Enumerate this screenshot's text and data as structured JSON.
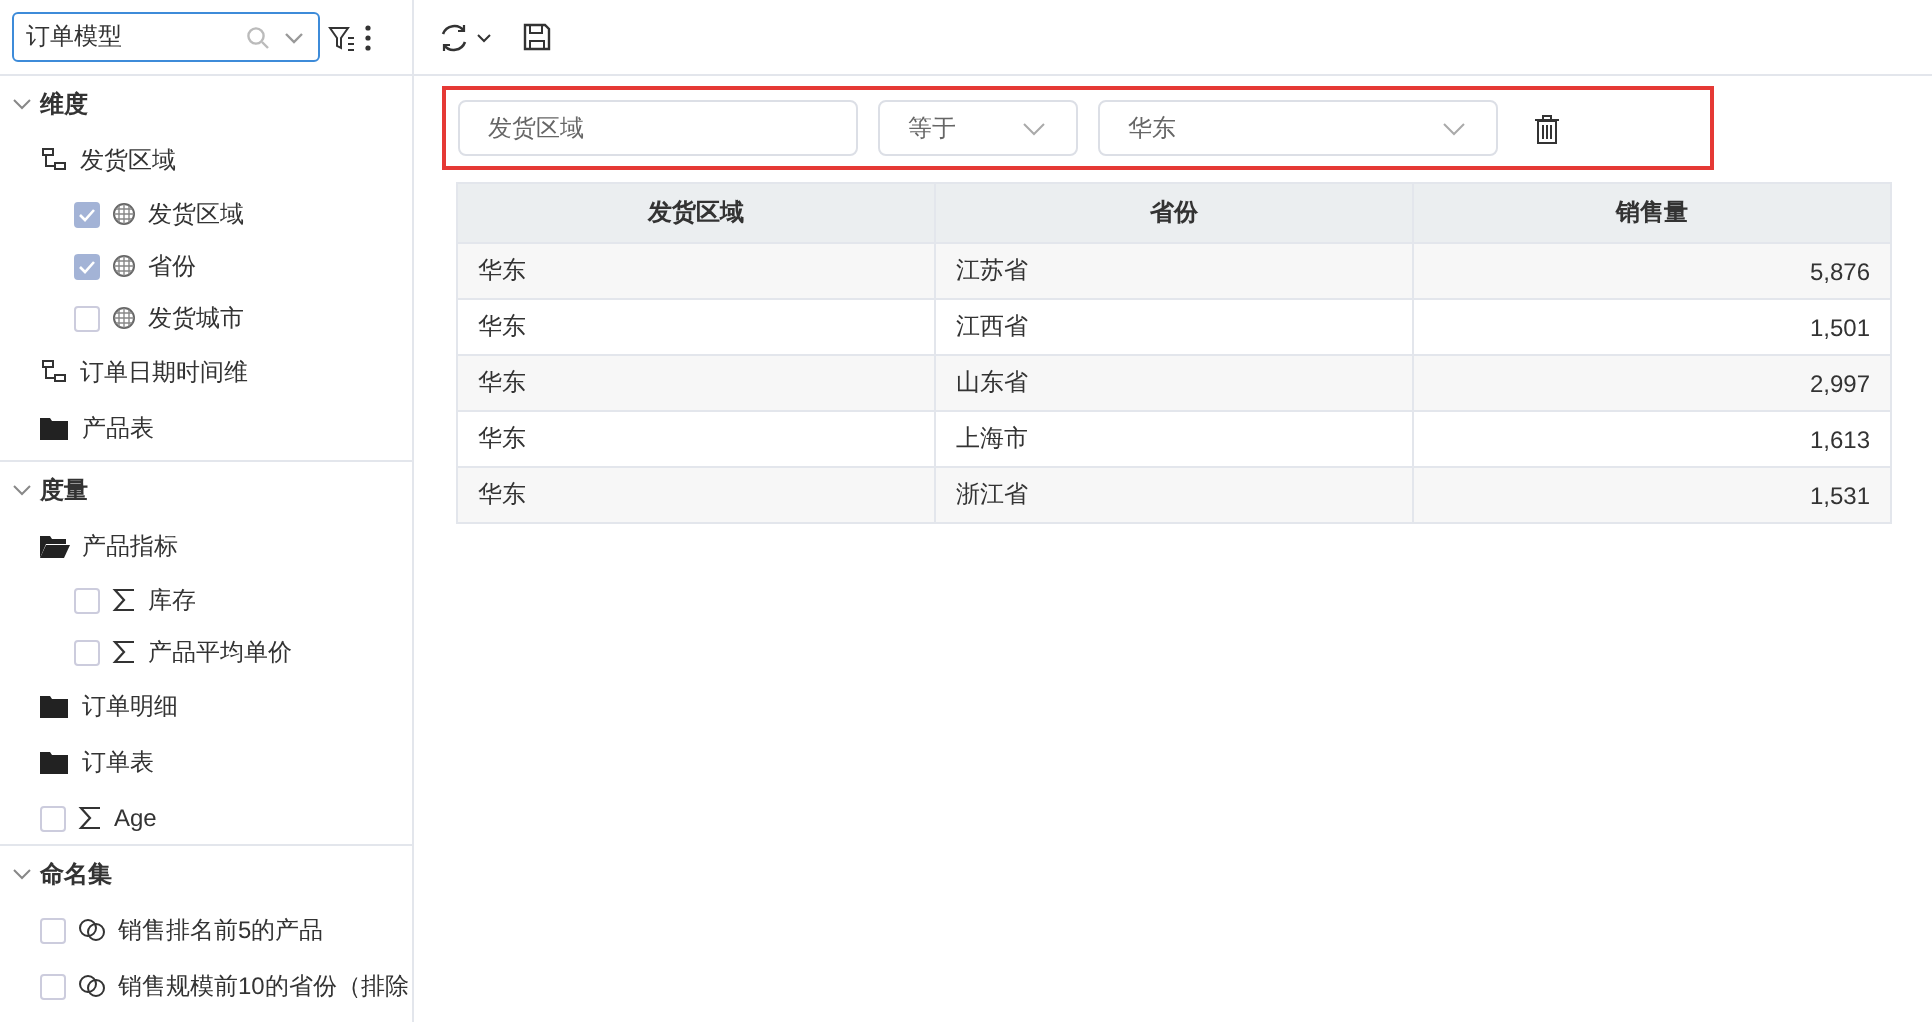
{
  "sidebar": {
    "model_select": {
      "value": "订单模型"
    },
    "sections": [
      {
        "title": "维度",
        "expanded": true,
        "items": [
          {
            "label": "发货区域",
            "kind": "hierarchy",
            "children": [
              {
                "label": "发货区域",
                "kind": "dimension",
                "checked": true
              },
              {
                "label": "省份",
                "kind": "dimension",
                "checked": true
              },
              {
                "label": "发货城市",
                "kind": "dimension",
                "checked": false
              }
            ]
          },
          {
            "label": "订单日期时间维",
            "kind": "hierarchy"
          },
          {
            "label": "产品表",
            "kind": "folder",
            "expanded": false
          }
        ]
      },
      {
        "title": "度量",
        "expanded": true,
        "items": [
          {
            "label": "产品指标",
            "kind": "folder",
            "expanded": true,
            "children": [
              {
                "label": "库存",
                "kind": "measure",
                "checked": false
              },
              {
                "label": "产品平均单价",
                "kind": "measure",
                "checked": false
              }
            ]
          },
          {
            "label": "订单明细",
            "kind": "folder",
            "expanded": false
          },
          {
            "label": "订单表",
            "kind": "folder",
            "expanded": false
          },
          {
            "label": "Age",
            "kind": "measure",
            "checked": false
          }
        ]
      },
      {
        "title": "命名集",
        "expanded": true,
        "items": [
          {
            "label": "销售排名前5的产品",
            "kind": "set",
            "checked": false
          },
          {
            "label": "销售规模前10的省份（排除",
            "kind": "set",
            "checked": false
          }
        ]
      }
    ]
  },
  "filter": {
    "highlighted": true,
    "field": "发货区域",
    "operator": "等于",
    "value": "华东"
  },
  "table": {
    "columns": [
      {
        "label": "发货区域"
      },
      {
        "label": "省份"
      },
      {
        "label": "销售量"
      }
    ],
    "rows": [
      [
        "华东",
        "江苏省",
        "5,876"
      ],
      [
        "华东",
        "江西省",
        "1,501"
      ],
      [
        "华东",
        "山东省",
        "2,997"
      ],
      [
        "华东",
        "上海市",
        "1,613"
      ],
      [
        "华东",
        "浙江省",
        "1,531"
      ]
    ]
  }
}
